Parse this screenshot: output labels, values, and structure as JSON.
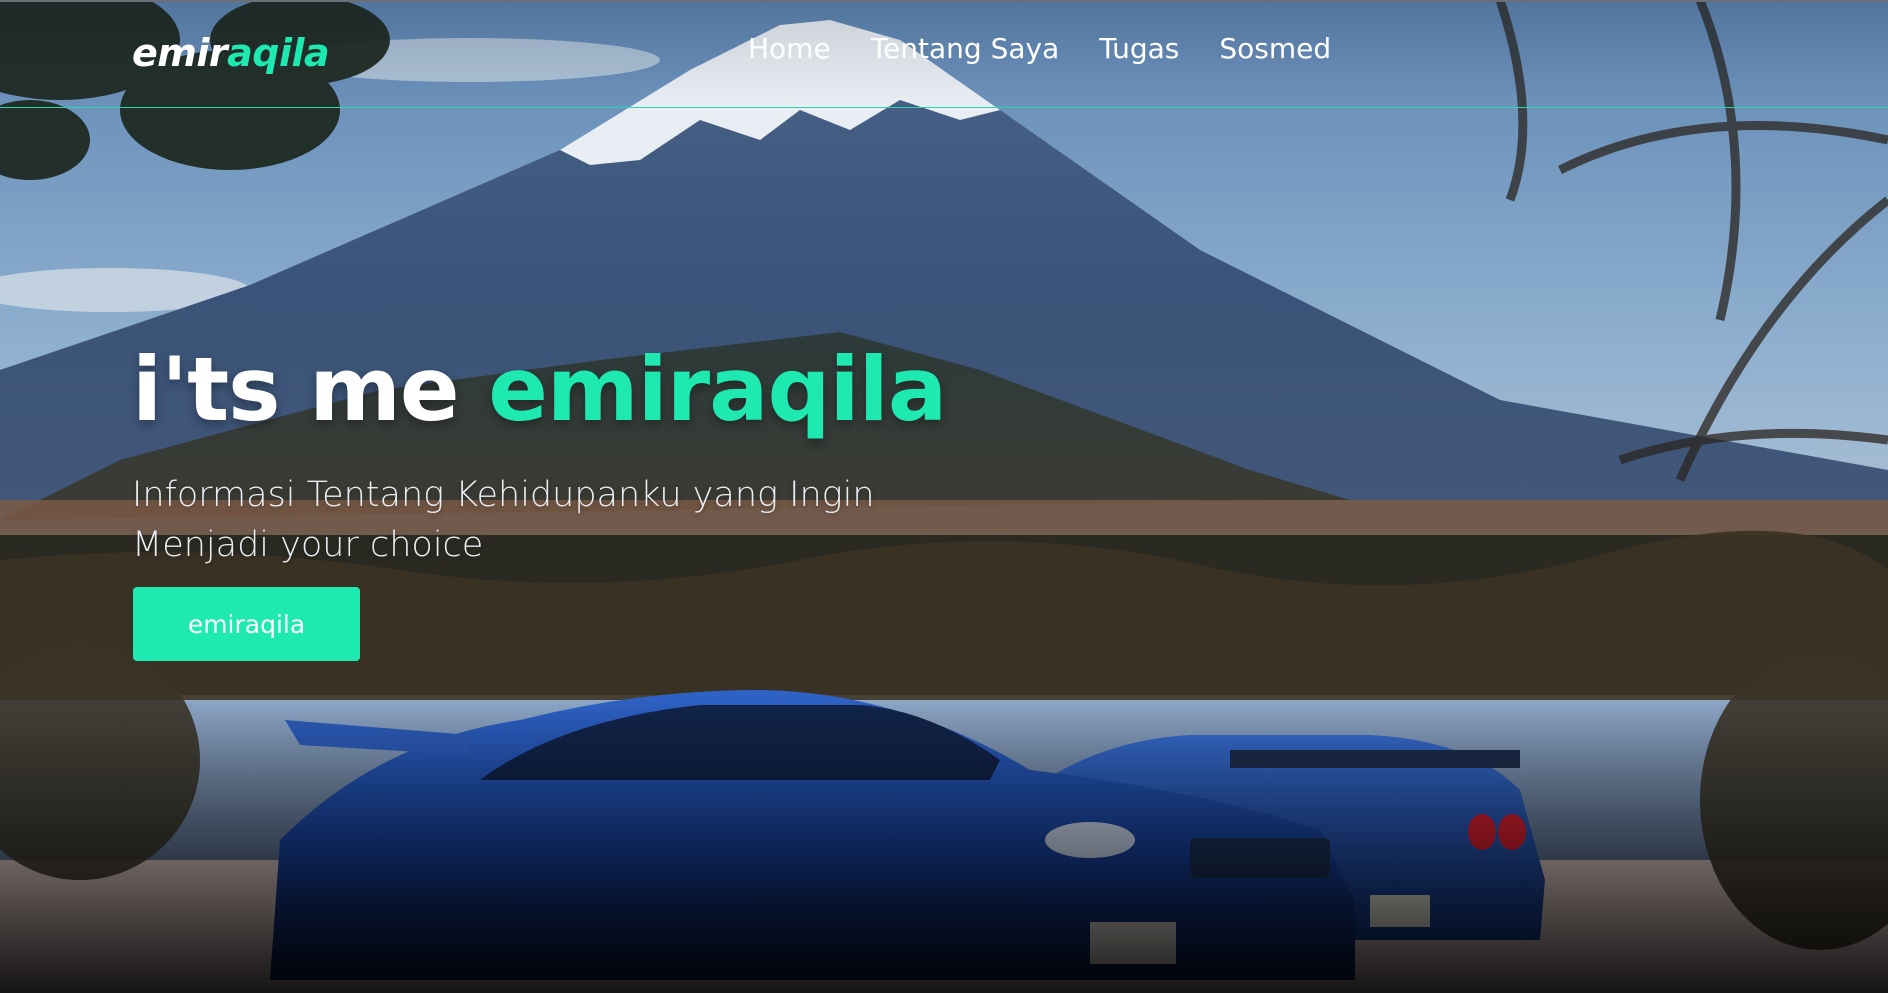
{
  "brand": {
    "first": "emir",
    "second": "aqila"
  },
  "nav": {
    "items": [
      {
        "label": "Home"
      },
      {
        "label": "Tentang Saya"
      },
      {
        "label": "Tugas"
      },
      {
        "label": "Sosmed"
      }
    ]
  },
  "hero": {
    "title_prefix": "i'ts me ",
    "title_highlight": "emiraqila",
    "subtitle": "Informasi Tentang Kehidupanku yang Ingin Menjadi your choice",
    "button_label": "emiraqila"
  },
  "colors": {
    "accent": "#1de9b0",
    "text": "#ffffff",
    "divider": "#2fd4a6"
  }
}
